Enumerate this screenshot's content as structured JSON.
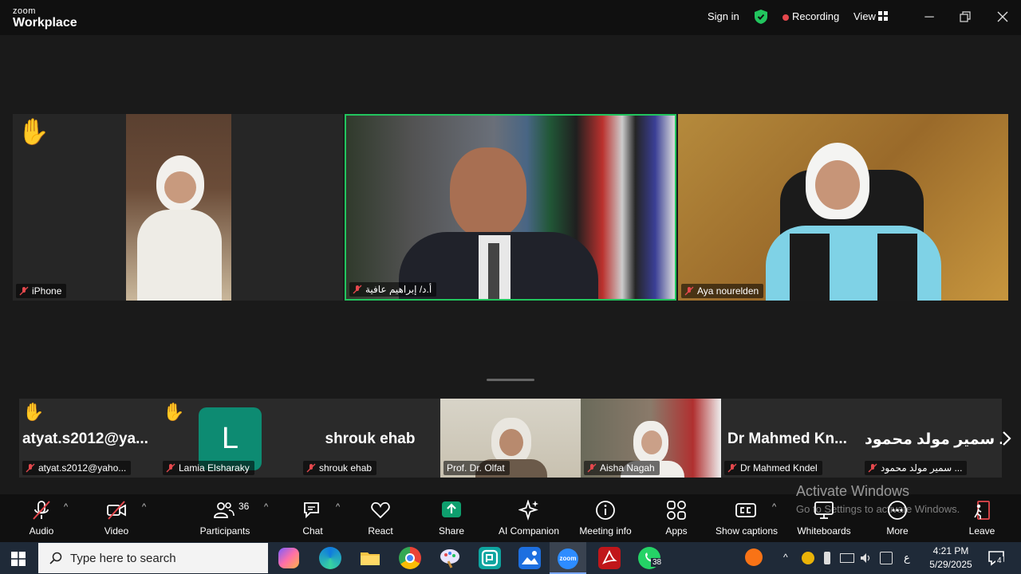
{
  "titlebar": {
    "logo_top": "zoom",
    "logo_bottom": "Workplace",
    "sign_in": "Sign in",
    "recording": "Recording",
    "view": "View"
  },
  "main_tiles": [
    {
      "name": "iPhone",
      "hand_raised": true
    },
    {
      "name": "أ.د/ إبراهيم عافية",
      "active_speaker": true,
      "accent": "#22c55e"
    },
    {
      "name": "Aya nourelden"
    }
  ],
  "strip": [
    {
      "big_name": "atyat.s2012@ya...",
      "name": "atyat.s2012@yaho...",
      "hand_raised": true
    },
    {
      "avatar_letter": "L",
      "name": "Lamia Elsharaky",
      "hand_raised": true
    },
    {
      "big_name": "shrouk ehab",
      "name": "shrouk ehab"
    },
    {
      "name": "Prof. Dr. Olfat"
    },
    {
      "name": "Aisha Nagah"
    },
    {
      "big_name": "Dr Mahmed Kn...",
      "name": "Dr Mahmed Kndel"
    },
    {
      "big_name": "سمير مولد محمود ...",
      "name": "سمير مولد محمود ..."
    }
  ],
  "toolbar": {
    "audio": "Audio",
    "video": "Video",
    "participants": "Participants",
    "participants_count": "36",
    "chat": "Chat",
    "react": "React",
    "share": "Share",
    "ai_companion": "AI Companion",
    "meeting_info": "Meeting info",
    "apps": "Apps",
    "show_captions": "Show captions",
    "whiteboards": "Whiteboards",
    "more": "More",
    "leave": "Leave"
  },
  "watermark": {
    "line1": "Activate Windows",
    "line2": "Go to Settings to activate Windows."
  },
  "taskbar": {
    "search_placeholder": "Type here to search",
    "whatsapp_badge": "38",
    "time": "4:21 PM",
    "date": "5/29/2025",
    "notification_count": "4",
    "lang": "ع"
  },
  "colors": {
    "share_green": "#0e9f6e",
    "record_red": "#e5484d",
    "leave_red": "#e5484d",
    "avatar_teal": "#0d8b72"
  }
}
